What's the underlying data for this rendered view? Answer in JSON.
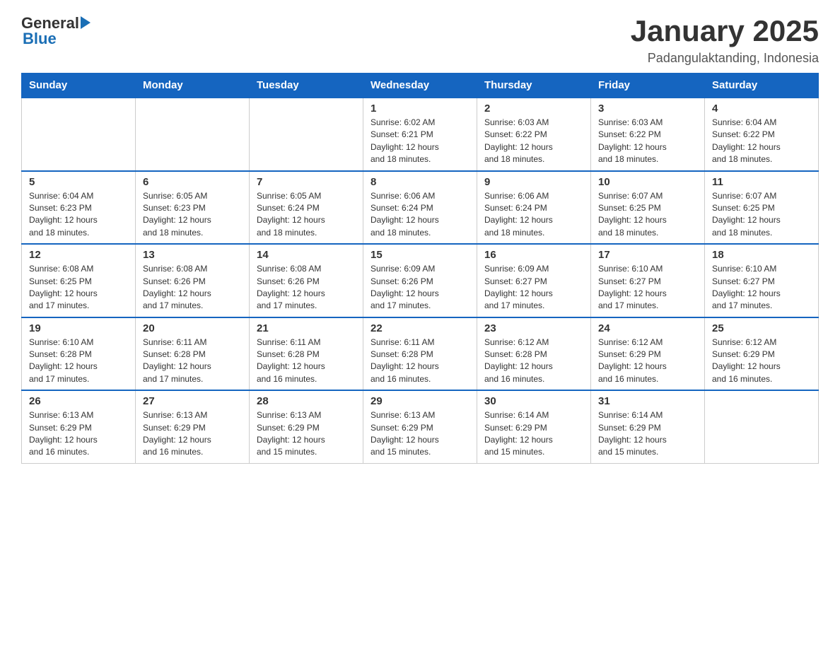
{
  "header": {
    "logo_general": "General",
    "logo_blue": "Blue",
    "month_title": "January 2025",
    "location": "Padangulaktanding, Indonesia"
  },
  "days_of_week": [
    "Sunday",
    "Monday",
    "Tuesday",
    "Wednesday",
    "Thursday",
    "Friday",
    "Saturday"
  ],
  "weeks": [
    [
      {
        "day": "",
        "info": ""
      },
      {
        "day": "",
        "info": ""
      },
      {
        "day": "",
        "info": ""
      },
      {
        "day": "1",
        "info": "Sunrise: 6:02 AM\nSunset: 6:21 PM\nDaylight: 12 hours\nand 18 minutes."
      },
      {
        "day": "2",
        "info": "Sunrise: 6:03 AM\nSunset: 6:22 PM\nDaylight: 12 hours\nand 18 minutes."
      },
      {
        "day": "3",
        "info": "Sunrise: 6:03 AM\nSunset: 6:22 PM\nDaylight: 12 hours\nand 18 minutes."
      },
      {
        "day": "4",
        "info": "Sunrise: 6:04 AM\nSunset: 6:22 PM\nDaylight: 12 hours\nand 18 minutes."
      }
    ],
    [
      {
        "day": "5",
        "info": "Sunrise: 6:04 AM\nSunset: 6:23 PM\nDaylight: 12 hours\nand 18 minutes."
      },
      {
        "day": "6",
        "info": "Sunrise: 6:05 AM\nSunset: 6:23 PM\nDaylight: 12 hours\nand 18 minutes."
      },
      {
        "day": "7",
        "info": "Sunrise: 6:05 AM\nSunset: 6:24 PM\nDaylight: 12 hours\nand 18 minutes."
      },
      {
        "day": "8",
        "info": "Sunrise: 6:06 AM\nSunset: 6:24 PM\nDaylight: 12 hours\nand 18 minutes."
      },
      {
        "day": "9",
        "info": "Sunrise: 6:06 AM\nSunset: 6:24 PM\nDaylight: 12 hours\nand 18 minutes."
      },
      {
        "day": "10",
        "info": "Sunrise: 6:07 AM\nSunset: 6:25 PM\nDaylight: 12 hours\nand 18 minutes."
      },
      {
        "day": "11",
        "info": "Sunrise: 6:07 AM\nSunset: 6:25 PM\nDaylight: 12 hours\nand 18 minutes."
      }
    ],
    [
      {
        "day": "12",
        "info": "Sunrise: 6:08 AM\nSunset: 6:25 PM\nDaylight: 12 hours\nand 17 minutes."
      },
      {
        "day": "13",
        "info": "Sunrise: 6:08 AM\nSunset: 6:26 PM\nDaylight: 12 hours\nand 17 minutes."
      },
      {
        "day": "14",
        "info": "Sunrise: 6:08 AM\nSunset: 6:26 PM\nDaylight: 12 hours\nand 17 minutes."
      },
      {
        "day": "15",
        "info": "Sunrise: 6:09 AM\nSunset: 6:26 PM\nDaylight: 12 hours\nand 17 minutes."
      },
      {
        "day": "16",
        "info": "Sunrise: 6:09 AM\nSunset: 6:27 PM\nDaylight: 12 hours\nand 17 minutes."
      },
      {
        "day": "17",
        "info": "Sunrise: 6:10 AM\nSunset: 6:27 PM\nDaylight: 12 hours\nand 17 minutes."
      },
      {
        "day": "18",
        "info": "Sunrise: 6:10 AM\nSunset: 6:27 PM\nDaylight: 12 hours\nand 17 minutes."
      }
    ],
    [
      {
        "day": "19",
        "info": "Sunrise: 6:10 AM\nSunset: 6:28 PM\nDaylight: 12 hours\nand 17 minutes."
      },
      {
        "day": "20",
        "info": "Sunrise: 6:11 AM\nSunset: 6:28 PM\nDaylight: 12 hours\nand 17 minutes."
      },
      {
        "day": "21",
        "info": "Sunrise: 6:11 AM\nSunset: 6:28 PM\nDaylight: 12 hours\nand 16 minutes."
      },
      {
        "day": "22",
        "info": "Sunrise: 6:11 AM\nSunset: 6:28 PM\nDaylight: 12 hours\nand 16 minutes."
      },
      {
        "day": "23",
        "info": "Sunrise: 6:12 AM\nSunset: 6:28 PM\nDaylight: 12 hours\nand 16 minutes."
      },
      {
        "day": "24",
        "info": "Sunrise: 6:12 AM\nSunset: 6:29 PM\nDaylight: 12 hours\nand 16 minutes."
      },
      {
        "day": "25",
        "info": "Sunrise: 6:12 AM\nSunset: 6:29 PM\nDaylight: 12 hours\nand 16 minutes."
      }
    ],
    [
      {
        "day": "26",
        "info": "Sunrise: 6:13 AM\nSunset: 6:29 PM\nDaylight: 12 hours\nand 16 minutes."
      },
      {
        "day": "27",
        "info": "Sunrise: 6:13 AM\nSunset: 6:29 PM\nDaylight: 12 hours\nand 16 minutes."
      },
      {
        "day": "28",
        "info": "Sunrise: 6:13 AM\nSunset: 6:29 PM\nDaylight: 12 hours\nand 15 minutes."
      },
      {
        "day": "29",
        "info": "Sunrise: 6:13 AM\nSunset: 6:29 PM\nDaylight: 12 hours\nand 15 minutes."
      },
      {
        "day": "30",
        "info": "Sunrise: 6:14 AM\nSunset: 6:29 PM\nDaylight: 12 hours\nand 15 minutes."
      },
      {
        "day": "31",
        "info": "Sunrise: 6:14 AM\nSunset: 6:29 PM\nDaylight: 12 hours\nand 15 minutes."
      },
      {
        "day": "",
        "info": ""
      }
    ]
  ]
}
